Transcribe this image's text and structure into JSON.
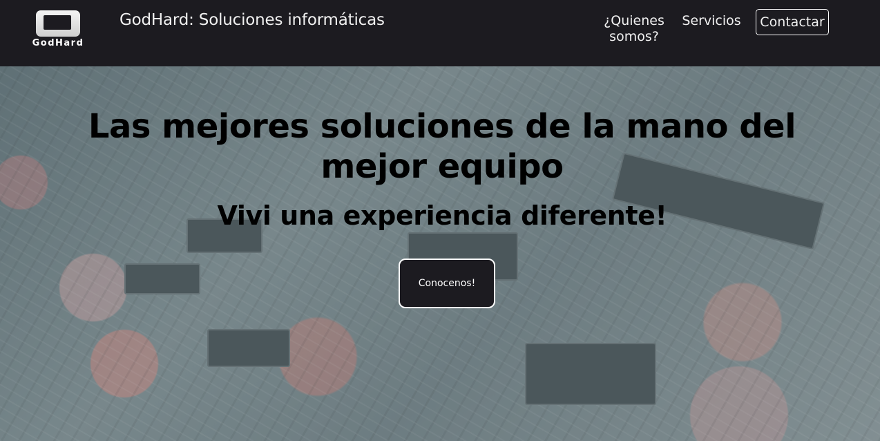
{
  "header": {
    "logo_text": "GodHard",
    "title": "GodHard: Soluciones informáticas",
    "nav": {
      "about": "¿Quienes somos?",
      "services": "Servicios",
      "contact": "Contactar"
    }
  },
  "hero": {
    "title": "Las mejores soluciones de la mano del mejor equipo",
    "subtitle": "Vivi una experiencia diferente!",
    "button_label": "Conocenos!"
  },
  "colors": {
    "header_bg": "#1c1b20",
    "button_bg": "#1c1b20",
    "text_light": "#ffffff"
  },
  "icons": {
    "logo": "monitor-icon"
  }
}
